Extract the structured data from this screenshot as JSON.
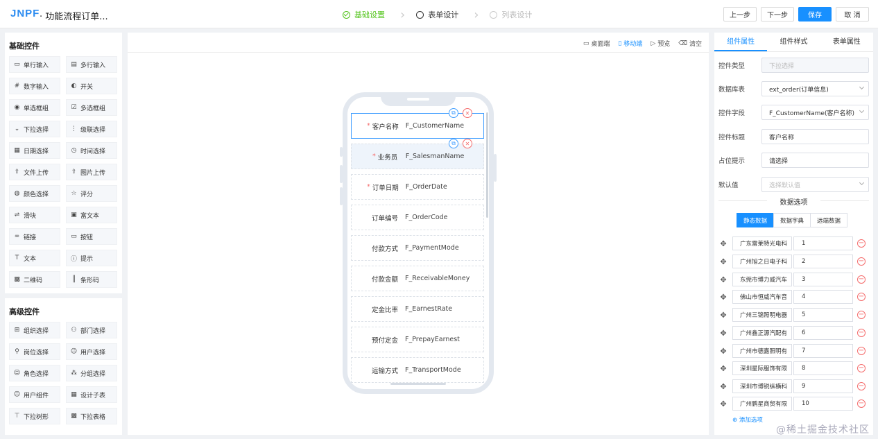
{
  "header": {
    "logo": "JNPF",
    "title": "· 功能流程订单...",
    "steps": [
      {
        "label": "基础设置",
        "state": "done"
      },
      {
        "label": "表单设计",
        "state": "current"
      },
      {
        "label": "列表设计",
        "state": "todo"
      }
    ],
    "buttons": {
      "prev": "上一步",
      "next": "下一步",
      "save": "保存",
      "cancel": "取 消"
    }
  },
  "basic_controls": {
    "title": "基础控件",
    "items": [
      {
        "label": "单行输入",
        "icon": "input-icon"
      },
      {
        "label": "多行输入",
        "icon": "textarea-icon"
      },
      {
        "label": "数字输入",
        "icon": "number-icon"
      },
      {
        "label": "开关",
        "icon": "switch-icon"
      },
      {
        "label": "单选框组",
        "icon": "radio-icon"
      },
      {
        "label": "多选框组",
        "icon": "checkbox-icon"
      },
      {
        "label": "下拉选择",
        "icon": "select-icon"
      },
      {
        "label": "级联选择",
        "icon": "cascader-icon"
      },
      {
        "label": "日期选择",
        "icon": "calendar-icon"
      },
      {
        "label": "时间选择",
        "icon": "clock-icon"
      },
      {
        "label": "文件上传",
        "icon": "upload-icon"
      },
      {
        "label": "图片上传",
        "icon": "image-upload-icon"
      },
      {
        "label": "颜色选择",
        "icon": "palette-icon"
      },
      {
        "label": "评分",
        "icon": "star-icon"
      },
      {
        "label": "滑块",
        "icon": "slider-icon"
      },
      {
        "label": "富文本",
        "icon": "richtext-icon"
      },
      {
        "label": "链接",
        "icon": "link-icon"
      },
      {
        "label": "按钮",
        "icon": "button-icon"
      },
      {
        "label": "文本",
        "icon": "text-icon"
      },
      {
        "label": "提示",
        "icon": "info-icon"
      },
      {
        "label": "二维码",
        "icon": "qrcode-icon"
      },
      {
        "label": "条形码",
        "icon": "barcode-icon"
      }
    ]
  },
  "advanced_controls": {
    "title": "高级控件",
    "items": [
      {
        "label": "组织选择",
        "icon": "org-icon"
      },
      {
        "label": "部门选择",
        "icon": "dept-icon"
      },
      {
        "label": "岗位选择",
        "icon": "post-icon"
      },
      {
        "label": "用户选择",
        "icon": "user-icon"
      },
      {
        "label": "角色选择",
        "icon": "role-icon"
      },
      {
        "label": "分组选择",
        "icon": "group-icon"
      },
      {
        "label": "用户组件",
        "icon": "user-component-icon"
      },
      {
        "label": "设计子表",
        "icon": "table-icon"
      },
      {
        "label": "下拉树形",
        "icon": "tree-icon"
      },
      {
        "label": "下拉表格",
        "icon": "grid-icon"
      }
    ]
  },
  "canvas": {
    "tools": [
      {
        "label": "桌面端",
        "icon": "desktop-icon",
        "active": false
      },
      {
        "label": "移动端",
        "icon": "mobile-icon",
        "active": true
      },
      {
        "label": "预览",
        "icon": "preview-icon",
        "active": false
      },
      {
        "label": "清空",
        "icon": "clear-icon",
        "active": false
      }
    ],
    "fields": [
      {
        "label": "客户名称",
        "field": "F_CustomerName",
        "required": true
      },
      {
        "label": "业务员",
        "field": "F_SalesmanName",
        "required": true
      },
      {
        "label": "订单日期",
        "field": "F_OrderDate",
        "required": true
      },
      {
        "label": "订单编号",
        "field": "F_OrderCode",
        "required": false
      },
      {
        "label": "付款方式",
        "field": "F_PaymentMode",
        "required": false
      },
      {
        "label": "付款金额",
        "field": "F_ReceivableMoney",
        "required": false
      },
      {
        "label": "定金比率",
        "field": "F_EarnestRate",
        "required": false
      },
      {
        "label": "预付定金",
        "field": "F_PrepayEarnest",
        "required": false
      },
      {
        "label": "运输方式",
        "field": "F_TransportMode",
        "required": false
      }
    ]
  },
  "properties": {
    "tabs": [
      "组件属性",
      "组件样式",
      "表单属性"
    ],
    "rows": [
      {
        "label": "控件类型",
        "value": "下拉选择"
      },
      {
        "label": "数据库表",
        "value": "ext_order(订单信息)"
      },
      {
        "label": "控件字段",
        "value": "F_CustomerName(客户名称)"
      },
      {
        "label": "控件标题",
        "value": "客户名称"
      },
      {
        "label": "占位提示",
        "value": "请选择"
      },
      {
        "label": "默认值",
        "value": "选择默认值"
      }
    ],
    "options_title": "数据选项",
    "source_tabs": [
      "静态数据",
      "数据字典",
      "远端数据"
    ],
    "options": [
      {
        "label": "广东雷莱特光电科",
        "value": "1"
      },
      {
        "label": "广州旭之日电子科",
        "value": "2"
      },
      {
        "label": "东莞市博力威汽车",
        "value": "3"
      },
      {
        "label": "佛山市恒威汽车音",
        "value": "4"
      },
      {
        "label": "广州三锦照明电器",
        "value": "5"
      },
      {
        "label": "广州鑫正源汽配有",
        "value": "6"
      },
      {
        "label": "广州市德嘉照明有",
        "value": "7"
      },
      {
        "label": "深圳星际服饰有限",
        "value": "8"
      },
      {
        "label": "深圳市博锐纵横科",
        "value": "9"
      },
      {
        "label": "广州鹏星商贸有限",
        "value": "10"
      }
    ],
    "add_option": "添加选项"
  },
  "watermark": "@稀土掘金技术社区"
}
